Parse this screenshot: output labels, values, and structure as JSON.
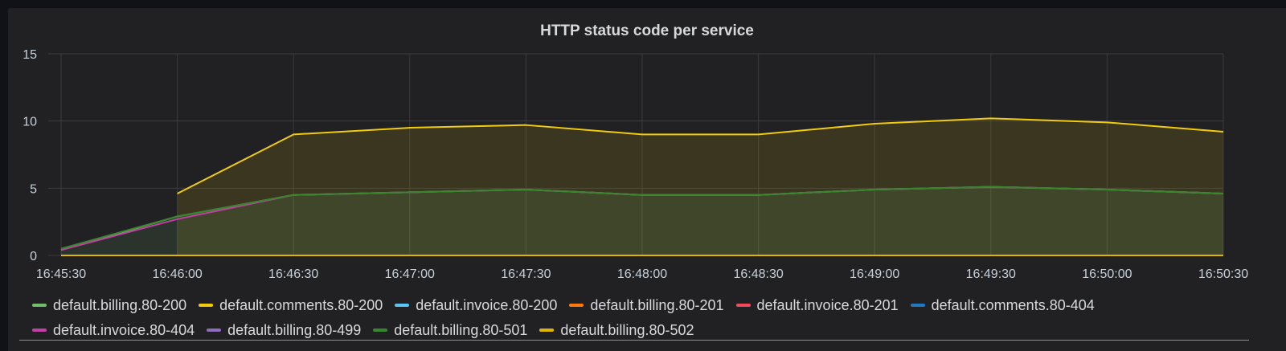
{
  "panel": {
    "title": "HTTP status code per service"
  },
  "chart_data": {
    "type": "area",
    "title": "HTTP status code per service",
    "xlabel": "",
    "ylabel": "",
    "x": [
      "16:45:30",
      "16:46:00",
      "16:46:30",
      "16:47:00",
      "16:47:30",
      "16:48:00",
      "16:48:30",
      "16:49:00",
      "16:49:30",
      "16:50:00",
      "16:50:30"
    ],
    "x_ticks": [
      "16:45:30",
      "16:46:00",
      "16:46:30",
      "16:47:00",
      "16:47:30",
      "16:48:00",
      "16:48:30",
      "16:49:00",
      "16:49:30",
      "16:50:00",
      "16:50:30"
    ],
    "ylim": [
      0,
      15
    ],
    "y_ticks": [
      "0",
      "5",
      "10",
      "15"
    ],
    "y_tick_values": [
      0,
      5,
      10,
      15
    ],
    "grid": true,
    "legend_position": "bottom",
    "series": [
      {
        "name": "default.billing.80-200",
        "color": "#73bf69",
        "values": [
          0.4,
          2.9,
          4.5,
          4.7,
          4.9,
          4.5,
          4.5,
          4.9,
          5.1,
          4.9,
          4.6
        ],
        "fill": true
      },
      {
        "name": "default.comments.80-200",
        "color": "#f2cc0c",
        "values": [
          null,
          4.6,
          9.0,
          9.5,
          9.7,
          9.0,
          9.0,
          9.8,
          10.2,
          9.9,
          9.2
        ],
        "fill": true
      },
      {
        "name": "default.invoice.80-200",
        "color": "#5ac4f5",
        "values": [
          0,
          0,
          0,
          0,
          0,
          0,
          0,
          0,
          0,
          0,
          0
        ]
      },
      {
        "name": "default.billing.80-201",
        "color": "#ff780a",
        "values": [
          0,
          0,
          0,
          0,
          0,
          0,
          0,
          0,
          0,
          0,
          0
        ]
      },
      {
        "name": "default.invoice.80-201",
        "color": "#f2495c",
        "values": [
          0,
          0,
          0,
          0,
          0,
          0,
          0,
          0,
          0,
          0,
          0
        ]
      },
      {
        "name": "default.comments.80-404",
        "color": "#1f78c1",
        "values": [
          0,
          0,
          0,
          0,
          0,
          0,
          0,
          0,
          0,
          0,
          0
        ]
      },
      {
        "name": "default.invoice.80-404",
        "color": "#c33fa6",
        "values": [
          0.4,
          2.7,
          4.5,
          4.7,
          4.9,
          4.5,
          4.5,
          4.9,
          5.1,
          4.9,
          4.6
        ]
      },
      {
        "name": "default.billing.80-499",
        "color": "#8f6dbe",
        "values": [
          0,
          0,
          0,
          0,
          0,
          0,
          0,
          0,
          0,
          0,
          0
        ]
      },
      {
        "name": "default.billing.80-501",
        "color": "#37872d",
        "values": [
          0.5,
          2.9,
          4.5,
          4.7,
          4.9,
          4.5,
          4.5,
          4.9,
          5.1,
          4.9,
          4.6
        ]
      },
      {
        "name": "default.billing.80-502",
        "color": "#e0b400",
        "values": [
          0,
          0,
          0,
          0,
          0,
          0,
          0,
          0,
          0,
          0,
          0
        ]
      }
    ]
  }
}
